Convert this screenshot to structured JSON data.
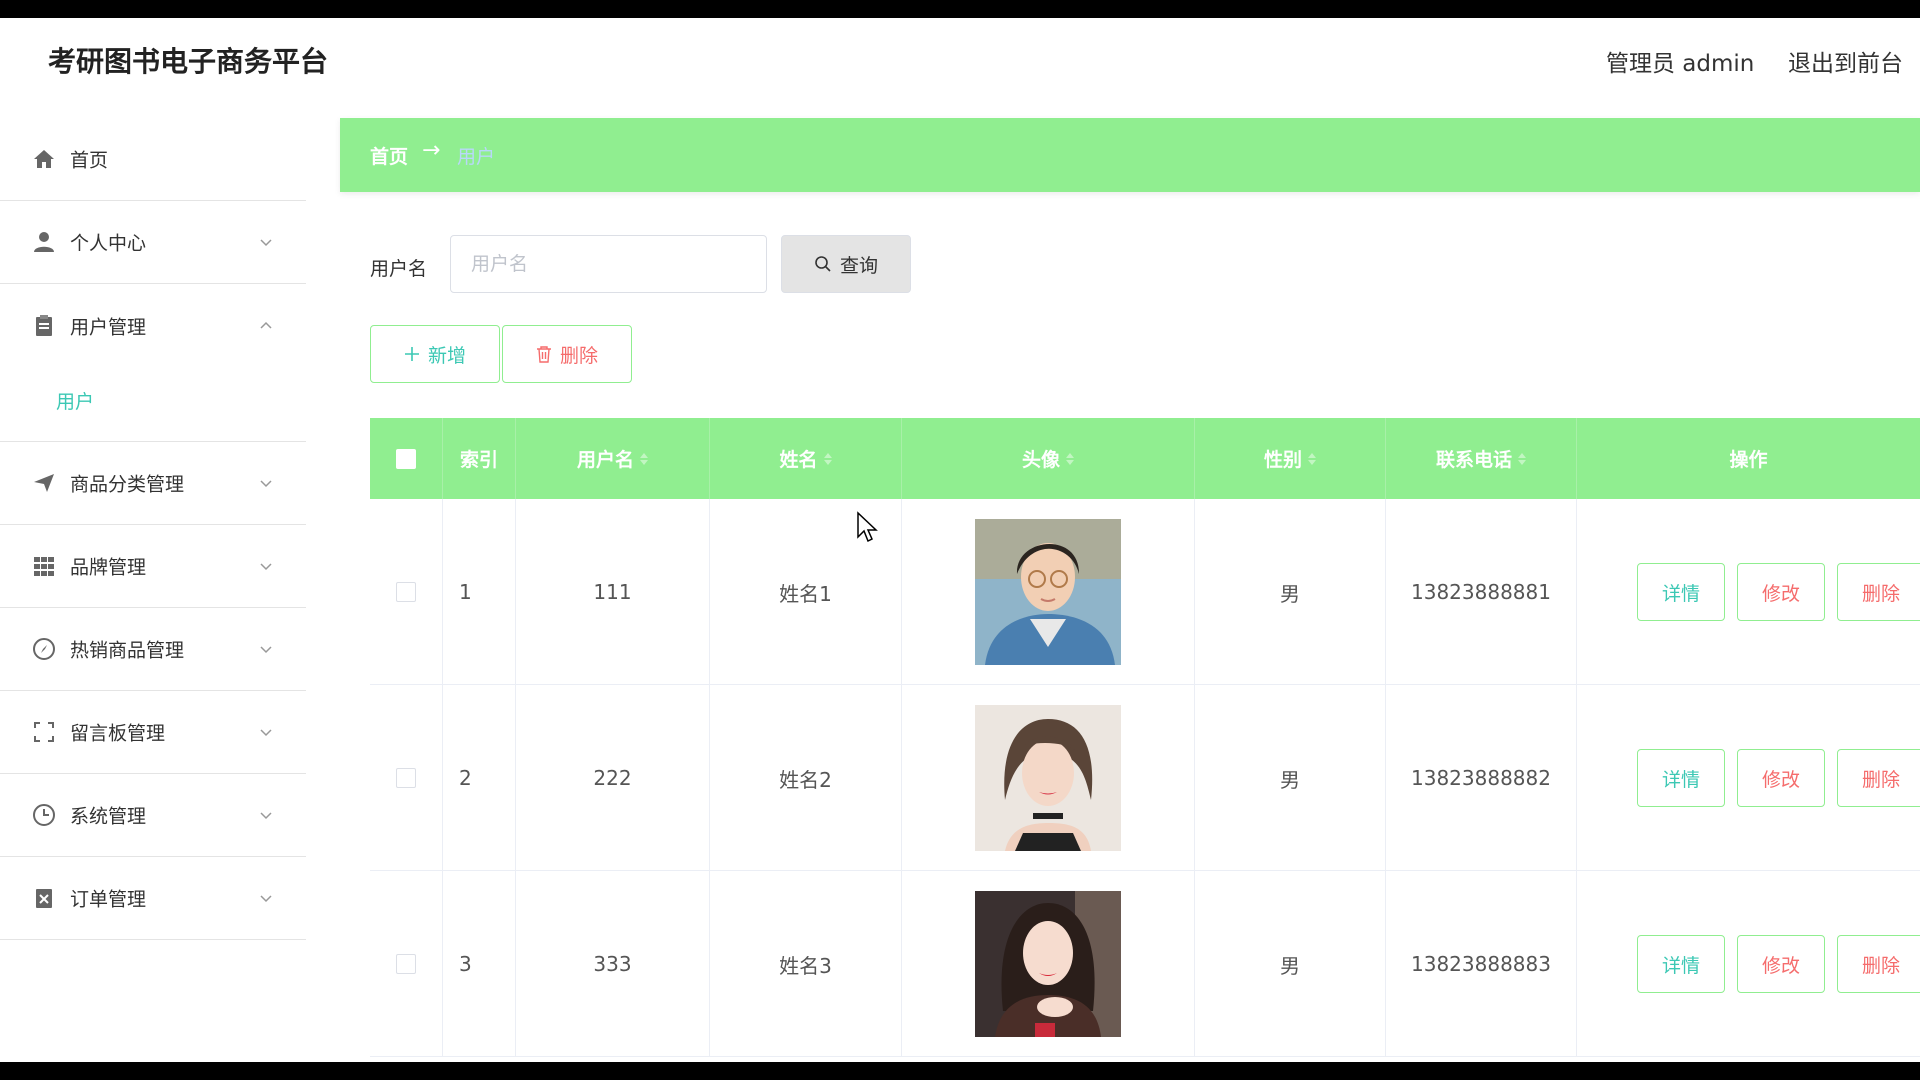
{
  "app": {
    "title": "考研图书电子商务平台"
  },
  "header": {
    "user_label": "管理员 admin",
    "exit_label": "退出到前台"
  },
  "sidebar": {
    "items": [
      {
        "label": "首页",
        "icon": "home-icon",
        "arrow": ""
      },
      {
        "label": "个人中心",
        "icon": "user-icon",
        "arrow": "down"
      },
      {
        "label": "用户管理",
        "icon": "clipboard-icon",
        "arrow": "up",
        "children": [
          {
            "label": "用户"
          }
        ]
      },
      {
        "label": "商品分类管理",
        "icon": "send-icon",
        "arrow": "down"
      },
      {
        "label": "品牌管理",
        "icon": "grid-icon",
        "arrow": "down"
      },
      {
        "label": "热销商品管理",
        "icon": "compass-icon",
        "arrow": "down"
      },
      {
        "label": "留言板管理",
        "icon": "fullscreen-icon",
        "arrow": "down"
      },
      {
        "label": "系统管理",
        "icon": "clock-icon",
        "arrow": "down"
      },
      {
        "label": "订单管理",
        "icon": "order-icon",
        "arrow": "down"
      }
    ]
  },
  "breadcrumb": {
    "home": "首页",
    "separator": "→",
    "current": "用户"
  },
  "search": {
    "label": "用户名",
    "placeholder": "用户名",
    "value": "",
    "button_label": "查询"
  },
  "actions": {
    "add_label": "新增",
    "delete_label": "删除"
  },
  "table": {
    "columns": [
      "索引",
      "用户名",
      "姓名",
      "头像",
      "性别",
      "联系电话",
      "操作"
    ],
    "rows": [
      {
        "index": "1",
        "username": "111",
        "name": "姓名1",
        "avatar": "avatar-young-man",
        "gender": "男",
        "phone": "13823888881"
      },
      {
        "index": "2",
        "username": "222",
        "name": "姓名2",
        "avatar": "avatar-woman-short-hair",
        "gender": "男",
        "phone": "13823888882"
      },
      {
        "index": "3",
        "username": "333",
        "name": "姓名3",
        "avatar": "avatar-woman-dark-jacket",
        "gender": "男",
        "phone": "13823888883"
      }
    ],
    "row_actions": {
      "detail": "详情",
      "edit": "修改",
      "delete": "删除"
    }
  },
  "colors": {
    "accent_green": "#90ee90",
    "teal_text": "#3cc8b4",
    "danger_text": "#f56c6c",
    "crumb_current": "#b8d8f8"
  }
}
